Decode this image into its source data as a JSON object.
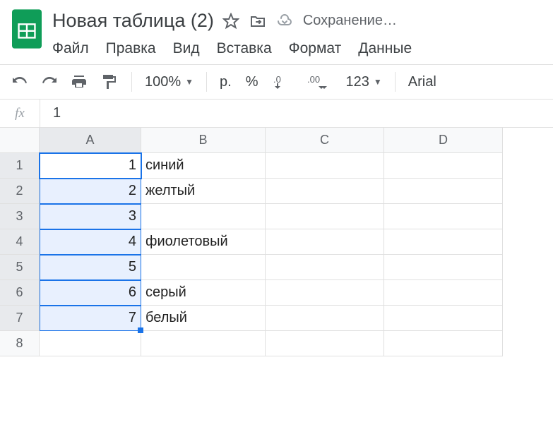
{
  "header": {
    "title": "Новая таблица (2)",
    "saving": "Сохранение…"
  },
  "menu": {
    "file": "Файл",
    "edit": "Правка",
    "view": "Вид",
    "insert": "Вставка",
    "format": "Формат",
    "data": "Данные"
  },
  "toolbar": {
    "zoom": "100%",
    "currency": "р.",
    "percent": "%",
    "dec_dec": ".0",
    "dec_inc": ".00",
    "numfmt": "123",
    "font": "Arial"
  },
  "formula_bar": {
    "fx": "fx",
    "value": "1"
  },
  "columns": [
    "A",
    "B",
    "C",
    "D"
  ],
  "rows": [
    "1",
    "2",
    "3",
    "4",
    "5",
    "6",
    "7",
    "8"
  ],
  "cells": {
    "A1": "1",
    "B1": "синий",
    "A2": "2",
    "B2": "желтый",
    "A3": "3",
    "B3": "",
    "A4": "4",
    "B4": "фиолетовый",
    "A5": "5",
    "B5": "",
    "A6": "6",
    "B6": "серый",
    "A7": "7",
    "B7": "белый"
  },
  "selection": {
    "range": "A1:A7",
    "active": "A1"
  }
}
